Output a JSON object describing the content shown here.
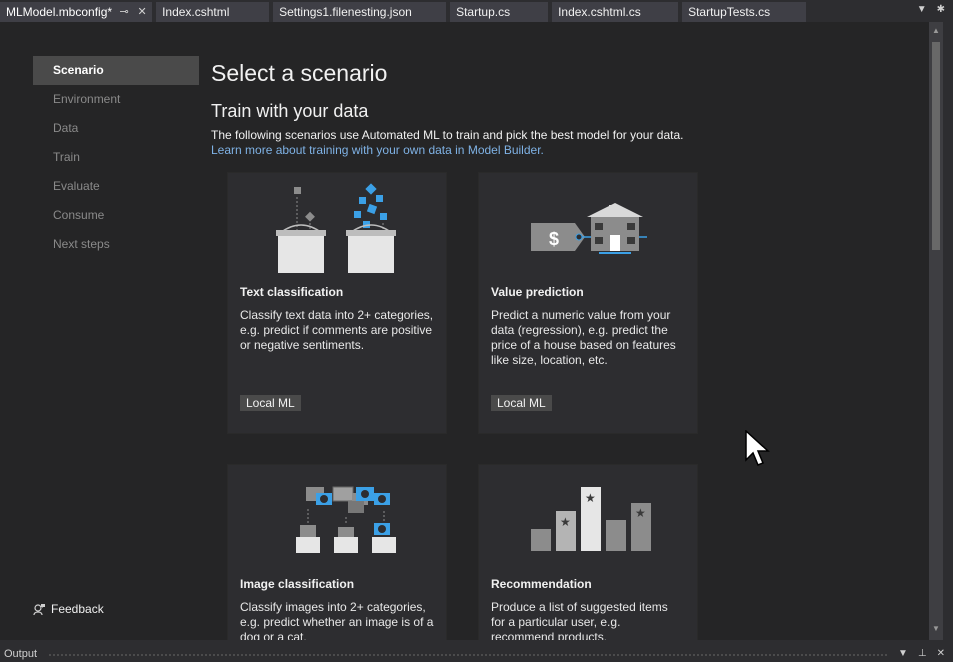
{
  "tabs": [
    {
      "label": "MLModel.mbconfig*",
      "active": true
    },
    {
      "label": "Index.cshtml"
    },
    {
      "label": "Settings1.filenesting.json"
    },
    {
      "label": "Startup.cs"
    },
    {
      "label": "Index.cshtml.cs"
    },
    {
      "label": "StartupTests.cs"
    }
  ],
  "nav": {
    "items": [
      {
        "label": "Scenario"
      },
      {
        "label": "Environment"
      },
      {
        "label": "Data"
      },
      {
        "label": "Train"
      },
      {
        "label": "Evaluate"
      },
      {
        "label": "Consume"
      },
      {
        "label": "Next steps"
      }
    ],
    "feedback": "Feedback"
  },
  "main": {
    "title": "Select a scenario",
    "subtitle": "Train with your data",
    "description": "The following scenarios use Automated ML to train and pick the best model for your data.",
    "learn_more": "Learn more about training with your own data in Model Builder."
  },
  "cards": [
    {
      "title": "Text classification",
      "description": "Classify text data into 2+ categories, e.g. predict if comments are positive or negative sentiments.",
      "badge": "Local ML"
    },
    {
      "title": "Value prediction",
      "description": "Predict a numeric value from your data (regression), e.g. predict the price of a house based on features like size, location, etc.",
      "badge": "Local ML"
    },
    {
      "title": "Image classification",
      "description": "Classify images into 2+ categories, e.g. predict whether an image is of a dog or a cat."
    },
    {
      "title": "Recommendation",
      "description": "Produce a list of suggested items for a particular user, e.g. recommend products."
    }
  ],
  "output": {
    "label": "Output"
  },
  "colors": {
    "accent_blue": "#3ba0e6",
    "link": "#7fb2e5",
    "background": "#252526"
  }
}
